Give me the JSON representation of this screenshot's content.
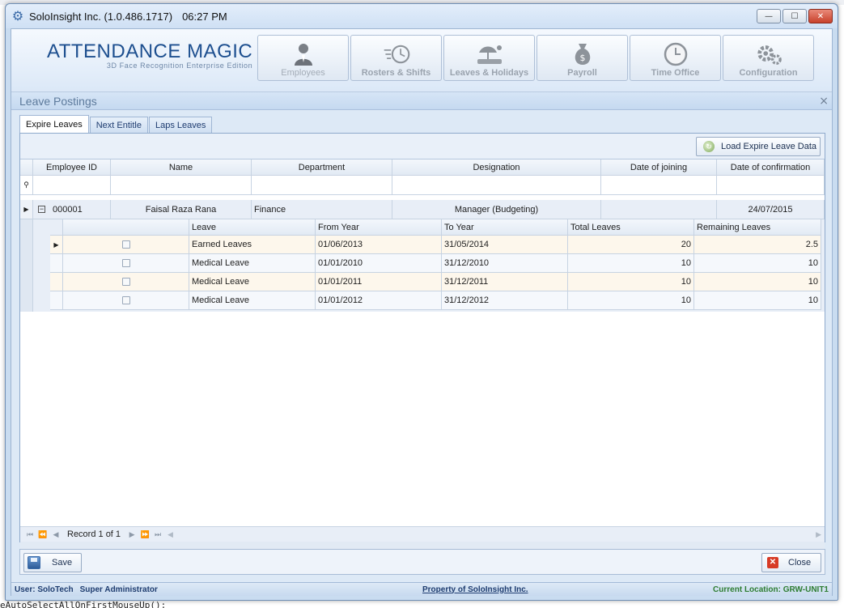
{
  "window": {
    "title": "SoloInsight Inc. (1.0.486.1717)",
    "time": "06:27 PM",
    "min_glyph": "—",
    "max_glyph": "☐",
    "close_glyph": "✕"
  },
  "background": {
    "code_line": "eAutoSelectAllOnFirstMouseUp();"
  },
  "brand": {
    "name": "ATTENDANCE MAGIC",
    "tagline": "3D Face Recognition Enterprise Edition"
  },
  "modules": [
    {
      "label": "Employees",
      "icon": "employee-icon"
    },
    {
      "label": "Rosters & Shifts",
      "icon": "clock-icon"
    },
    {
      "label": "Leaves & Holidays",
      "icon": "beach-icon"
    },
    {
      "label": "Payroll",
      "icon": "money-bag-icon"
    },
    {
      "label": "Time Office",
      "icon": "wall-clock-icon"
    },
    {
      "label": "Configuration",
      "icon": "gear-icon"
    }
  ],
  "panel": {
    "title": "Leave Postings",
    "close_glyph": "×"
  },
  "tabs": [
    "Expire Leaves",
    "Next Entitle",
    "Laps Leaves"
  ],
  "toolbar": {
    "load_label": "Load Expire Leave Data"
  },
  "grid": {
    "columns": [
      "Employee ID",
      "Name",
      "Department",
      "Designation",
      "Date of joining",
      "Date of confirmation"
    ],
    "filter_glyph": "⚲",
    "row": {
      "employee_id": "000001",
      "name": "Faisal Raza Rana",
      "department": "Finance",
      "designation": "Manager (Budgeting)",
      "date_of_joining": "",
      "date_of_confirmation": "24/07/2015"
    },
    "detail_columns": [
      "",
      "Leave",
      "From Year",
      "To Year",
      "Total Leaves",
      "Remaining Leaves"
    ],
    "detail_rows": [
      {
        "leave": "Earned Leaves",
        "from": "01/06/2013",
        "to": "31/05/2014",
        "total": "20",
        "remaining": "2.5"
      },
      {
        "leave": "Medical Leave",
        "from": "01/01/2010",
        "to": "31/12/2010",
        "total": "10",
        "remaining": "10"
      },
      {
        "leave": "Medical Leave",
        "from": "01/01/2011",
        "to": "31/12/2011",
        "total": "10",
        "remaining": "10"
      },
      {
        "leave": "Medical Leave",
        "from": "01/01/2012",
        "to": "31/12/2012",
        "total": "10",
        "remaining": "10"
      }
    ]
  },
  "navigator": {
    "record_text": "Record 1 of 1"
  },
  "buttons": {
    "save": "Save",
    "close": "Close"
  },
  "status": {
    "user": "User: SoloTech",
    "role": "Super Administrator",
    "property": "Property of SoloInsight Inc.",
    "location": "Current Location: GRW-UNIT1"
  }
}
